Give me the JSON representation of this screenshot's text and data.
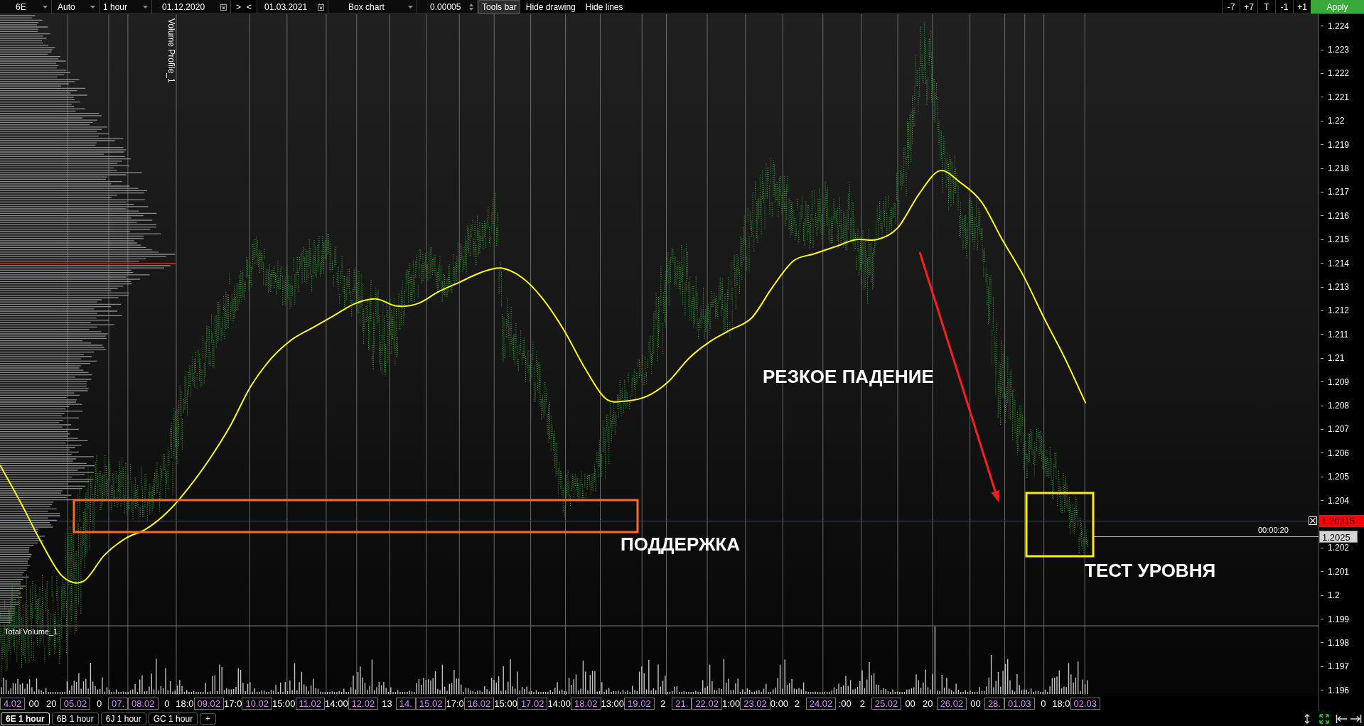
{
  "toolbar": {
    "instrument": "6E",
    "scale_mode": "Auto",
    "timeframe": "1 hour",
    "date_from": "01.12.2020",
    "range_buttons": [
      ">",
      "<"
    ],
    "date_to": "01.03.2021",
    "chart_type": "Box chart",
    "tick_size": "0.00005",
    "buttons": [
      {
        "label": "Tools bar",
        "selected": true
      },
      {
        "label": "Hide drawing",
        "selected": false
      },
      {
        "label": "Hide lines",
        "selected": false
      }
    ],
    "step_buttons": [
      "-7",
      "+7",
      "T",
      "-1",
      "+1"
    ],
    "apply_button": "Apply"
  },
  "chart": {
    "volume_profile_label": "Volume Profile_1",
    "price_axis": [
      "1.224",
      "1.223",
      "1.222",
      "1.221",
      "1.22",
      "1.219",
      "1.218",
      "1.217",
      "1.216",
      "1.215",
      "1.214",
      "1.213",
      "1.212",
      "1.211",
      "1.21",
      "1.209",
      "1.208",
      "1.207",
      "1.206",
      "1.205",
      "1.204",
      "1.202",
      "1.201",
      "1.2",
      "1.199",
      "1.198",
      "1.197",
      "1.196"
    ],
    "shapes": [
      {
        "kind": "arrow",
        "color": "#ff1e1e"
      },
      {
        "kind": "rectangle",
        "color": "#ff6a21"
      },
      {
        "kind": "rectangle",
        "color": "#ffee00"
      }
    ],
    "annotations": [
      "РЕЗКОЕ ПАДЕНИЕ",
      "ПОДДЕРЖКА",
      "ТЕСТ УРОВНЯ"
    ],
    "price_markers": [
      {
        "label": "1.20315",
        "color": "#ff0000"
      },
      {
        "label": "1.2025",
        "color": "#d4d4d4"
      }
    ],
    "timer": "00:00:20",
    "volume_panel_label": "Total Volume_1"
  },
  "time_axis": [
    {
      "label": "4.02",
      "kind": "date"
    },
    {
      "label": "00",
      "kind": "time"
    },
    {
      "label": "20",
      "kind": "time"
    },
    {
      "label": "05.02",
      "kind": "date"
    },
    {
      "label": "0",
      "kind": "time"
    },
    {
      "label": "07.",
      "kind": "date"
    },
    {
      "label": "08.02",
      "kind": "date"
    },
    {
      "label": "0",
      "kind": "time"
    },
    {
      "label": "18:0",
      "kind": "time"
    },
    {
      "label": "09.02",
      "kind": "date"
    },
    {
      "label": "17:0",
      "kind": "time"
    },
    {
      "label": "10.02",
      "kind": "date"
    },
    {
      "label": "15:00",
      "kind": "time"
    },
    {
      "label": "11.02",
      "kind": "date"
    },
    {
      "label": "14:00",
      "kind": "time"
    },
    {
      "label": "12.02",
      "kind": "date"
    },
    {
      "label": "13",
      "kind": "time"
    },
    {
      "label": "14.",
      "kind": "date"
    },
    {
      "label": "15.02",
      "kind": "date"
    },
    {
      "label": "17:0",
      "kind": "time"
    },
    {
      "label": "16.02",
      "kind": "date"
    },
    {
      "label": "15:00",
      "kind": "time"
    },
    {
      "label": "17.02",
      "kind": "date"
    },
    {
      "label": "14:00",
      "kind": "time"
    },
    {
      "label": "18.02",
      "kind": "date"
    },
    {
      "label": "13:00",
      "kind": "time"
    },
    {
      "label": "19.02",
      "kind": "date"
    },
    {
      "label": "2",
      "kind": "time"
    },
    {
      "label": "21.",
      "kind": "date"
    },
    {
      "label": "22.02",
      "kind": "date"
    },
    {
      "label": "1:00",
      "kind": "time"
    },
    {
      "label": "23.02",
      "kind": "date"
    },
    {
      "label": "0:00",
      "kind": "time"
    },
    {
      "label": "2",
      "kind": "time"
    },
    {
      "label": "24.02",
      "kind": "date"
    },
    {
      "label": ":00",
      "kind": "time"
    },
    {
      "label": "2",
      "kind": "time"
    },
    {
      "label": "25.02",
      "kind": "date"
    },
    {
      "label": "00",
      "kind": "time"
    },
    {
      "label": "20",
      "kind": "time"
    },
    {
      "label": "26.02",
      "kind": "date"
    },
    {
      "label": "00",
      "kind": "time"
    },
    {
      "label": "28.",
      "kind": "date"
    },
    {
      "label": "01.03",
      "kind": "date"
    },
    {
      "label": "0",
      "kind": "time"
    },
    {
      "label": "18:0",
      "kind": "time"
    },
    {
      "label": "02.03",
      "kind": "date"
    }
  ],
  "tabs": [
    {
      "label": "6E 1 hour",
      "selected": true
    },
    {
      "label": "6B 1 hour",
      "selected": false
    },
    {
      "label": "6J 1 hour",
      "selected": false
    },
    {
      "label": "GC 1 hour",
      "selected": false
    }
  ],
  "add_tab_button": "+"
}
